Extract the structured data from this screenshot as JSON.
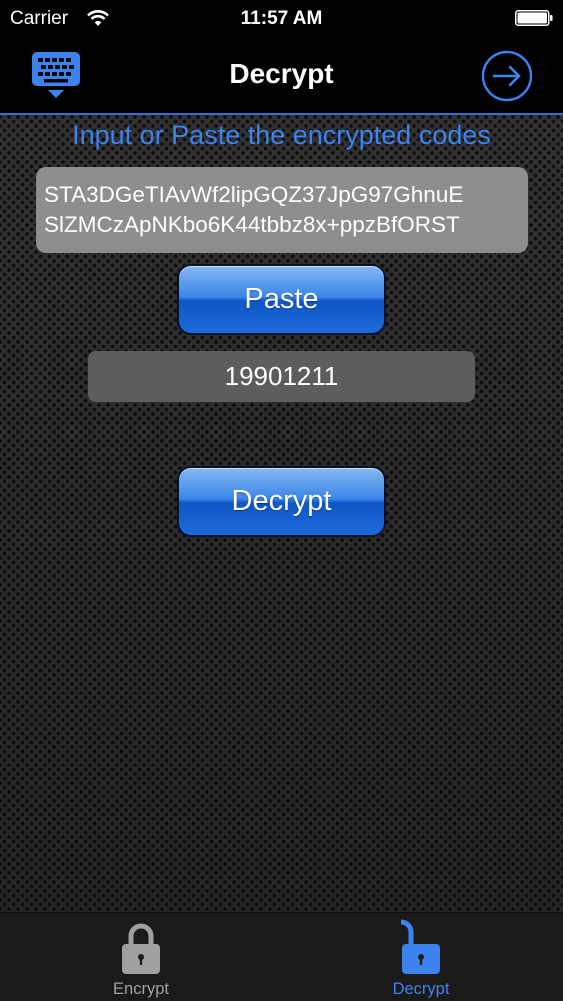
{
  "status": {
    "carrier": "Carrier",
    "time": "11:57 AM"
  },
  "nav": {
    "title": "Decrypt",
    "left_icon": "keyboard-icon",
    "right_icon": "arrow-right-circle-icon"
  },
  "main": {
    "instruction": "Input or Paste the encrypted codes",
    "codes": "STA3DGeTIAvWf2lipGQZ37JpG97GhnuE\nSlZMCzApNKbo6K44tbbz8x+ppzBfORST",
    "paste_label": "Paste",
    "password_value": "19901211",
    "decrypt_label": "Decrypt"
  },
  "tabs": [
    {
      "label": "Encrypt",
      "icon": "padlock-closed-icon",
      "selected": false
    },
    {
      "label": "Decrypt",
      "icon": "padlock-open-icon",
      "selected": true
    }
  ],
  "colors": {
    "accent": "#3d83f0",
    "button_blue": "#1c6ad8",
    "tab_inactive": "#a0a0a0"
  }
}
